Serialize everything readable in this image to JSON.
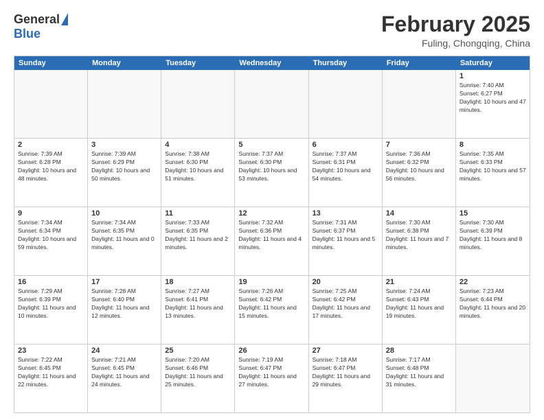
{
  "header": {
    "logo_general": "General",
    "logo_blue": "Blue",
    "main_title": "February 2025",
    "subtitle": "Fuling, Chongqing, China"
  },
  "calendar": {
    "days_of_week": [
      "Sunday",
      "Monday",
      "Tuesday",
      "Wednesday",
      "Thursday",
      "Friday",
      "Saturday"
    ],
    "rows": [
      [
        {
          "day": "",
          "empty": true
        },
        {
          "day": "",
          "empty": true
        },
        {
          "day": "",
          "empty": true
        },
        {
          "day": "",
          "empty": true
        },
        {
          "day": "",
          "empty": true
        },
        {
          "day": "",
          "empty": true
        },
        {
          "day": "1",
          "sunrise": "7:40 AM",
          "sunset": "6:27 PM",
          "daylight": "10 hours and 47 minutes."
        }
      ],
      [
        {
          "day": "2",
          "sunrise": "7:39 AM",
          "sunset": "6:28 PM",
          "daylight": "10 hours and 48 minutes."
        },
        {
          "day": "3",
          "sunrise": "7:39 AM",
          "sunset": "6:29 PM",
          "daylight": "10 hours and 50 minutes."
        },
        {
          "day": "4",
          "sunrise": "7:38 AM",
          "sunset": "6:30 PM",
          "daylight": "10 hours and 51 minutes."
        },
        {
          "day": "5",
          "sunrise": "7:37 AM",
          "sunset": "6:30 PM",
          "daylight": "10 hours and 53 minutes."
        },
        {
          "day": "6",
          "sunrise": "7:37 AM",
          "sunset": "6:31 PM",
          "daylight": "10 hours and 54 minutes."
        },
        {
          "day": "7",
          "sunrise": "7:36 AM",
          "sunset": "6:32 PM",
          "daylight": "10 hours and 56 minutes."
        },
        {
          "day": "8",
          "sunrise": "7:35 AM",
          "sunset": "6:33 PM",
          "daylight": "10 hours and 57 minutes."
        }
      ],
      [
        {
          "day": "9",
          "sunrise": "7:34 AM",
          "sunset": "6:34 PM",
          "daylight": "10 hours and 59 minutes."
        },
        {
          "day": "10",
          "sunrise": "7:34 AM",
          "sunset": "6:35 PM",
          "daylight": "11 hours and 0 minutes."
        },
        {
          "day": "11",
          "sunrise": "7:33 AM",
          "sunset": "6:35 PM",
          "daylight": "11 hours and 2 minutes."
        },
        {
          "day": "12",
          "sunrise": "7:32 AM",
          "sunset": "6:36 PM",
          "daylight": "11 hours and 4 minutes."
        },
        {
          "day": "13",
          "sunrise": "7:31 AM",
          "sunset": "6:37 PM",
          "daylight": "11 hours and 5 minutes."
        },
        {
          "day": "14",
          "sunrise": "7:30 AM",
          "sunset": "6:38 PM",
          "daylight": "11 hours and 7 minutes."
        },
        {
          "day": "15",
          "sunrise": "7:30 AM",
          "sunset": "6:39 PM",
          "daylight": "11 hours and 8 minutes."
        }
      ],
      [
        {
          "day": "16",
          "sunrise": "7:29 AM",
          "sunset": "6:39 PM",
          "daylight": "11 hours and 10 minutes."
        },
        {
          "day": "17",
          "sunrise": "7:28 AM",
          "sunset": "6:40 PM",
          "daylight": "11 hours and 12 minutes."
        },
        {
          "day": "18",
          "sunrise": "7:27 AM",
          "sunset": "6:41 PM",
          "daylight": "11 hours and 13 minutes."
        },
        {
          "day": "19",
          "sunrise": "7:26 AM",
          "sunset": "6:42 PM",
          "daylight": "11 hours and 15 minutes."
        },
        {
          "day": "20",
          "sunrise": "7:25 AM",
          "sunset": "6:42 PM",
          "daylight": "11 hours and 17 minutes."
        },
        {
          "day": "21",
          "sunrise": "7:24 AM",
          "sunset": "6:43 PM",
          "daylight": "11 hours and 19 minutes."
        },
        {
          "day": "22",
          "sunrise": "7:23 AM",
          "sunset": "6:44 PM",
          "daylight": "11 hours and 20 minutes."
        }
      ],
      [
        {
          "day": "23",
          "sunrise": "7:22 AM",
          "sunset": "6:45 PM",
          "daylight": "11 hours and 22 minutes."
        },
        {
          "day": "24",
          "sunrise": "7:21 AM",
          "sunset": "6:45 PM",
          "daylight": "11 hours and 24 minutes."
        },
        {
          "day": "25",
          "sunrise": "7:20 AM",
          "sunset": "6:46 PM",
          "daylight": "11 hours and 25 minutes."
        },
        {
          "day": "26",
          "sunrise": "7:19 AM",
          "sunset": "6:47 PM",
          "daylight": "11 hours and 27 minutes."
        },
        {
          "day": "27",
          "sunrise": "7:18 AM",
          "sunset": "6:47 PM",
          "daylight": "11 hours and 29 minutes."
        },
        {
          "day": "28",
          "sunrise": "7:17 AM",
          "sunset": "6:48 PM",
          "daylight": "11 hours and 31 minutes."
        },
        {
          "day": "",
          "empty": true
        }
      ]
    ]
  }
}
